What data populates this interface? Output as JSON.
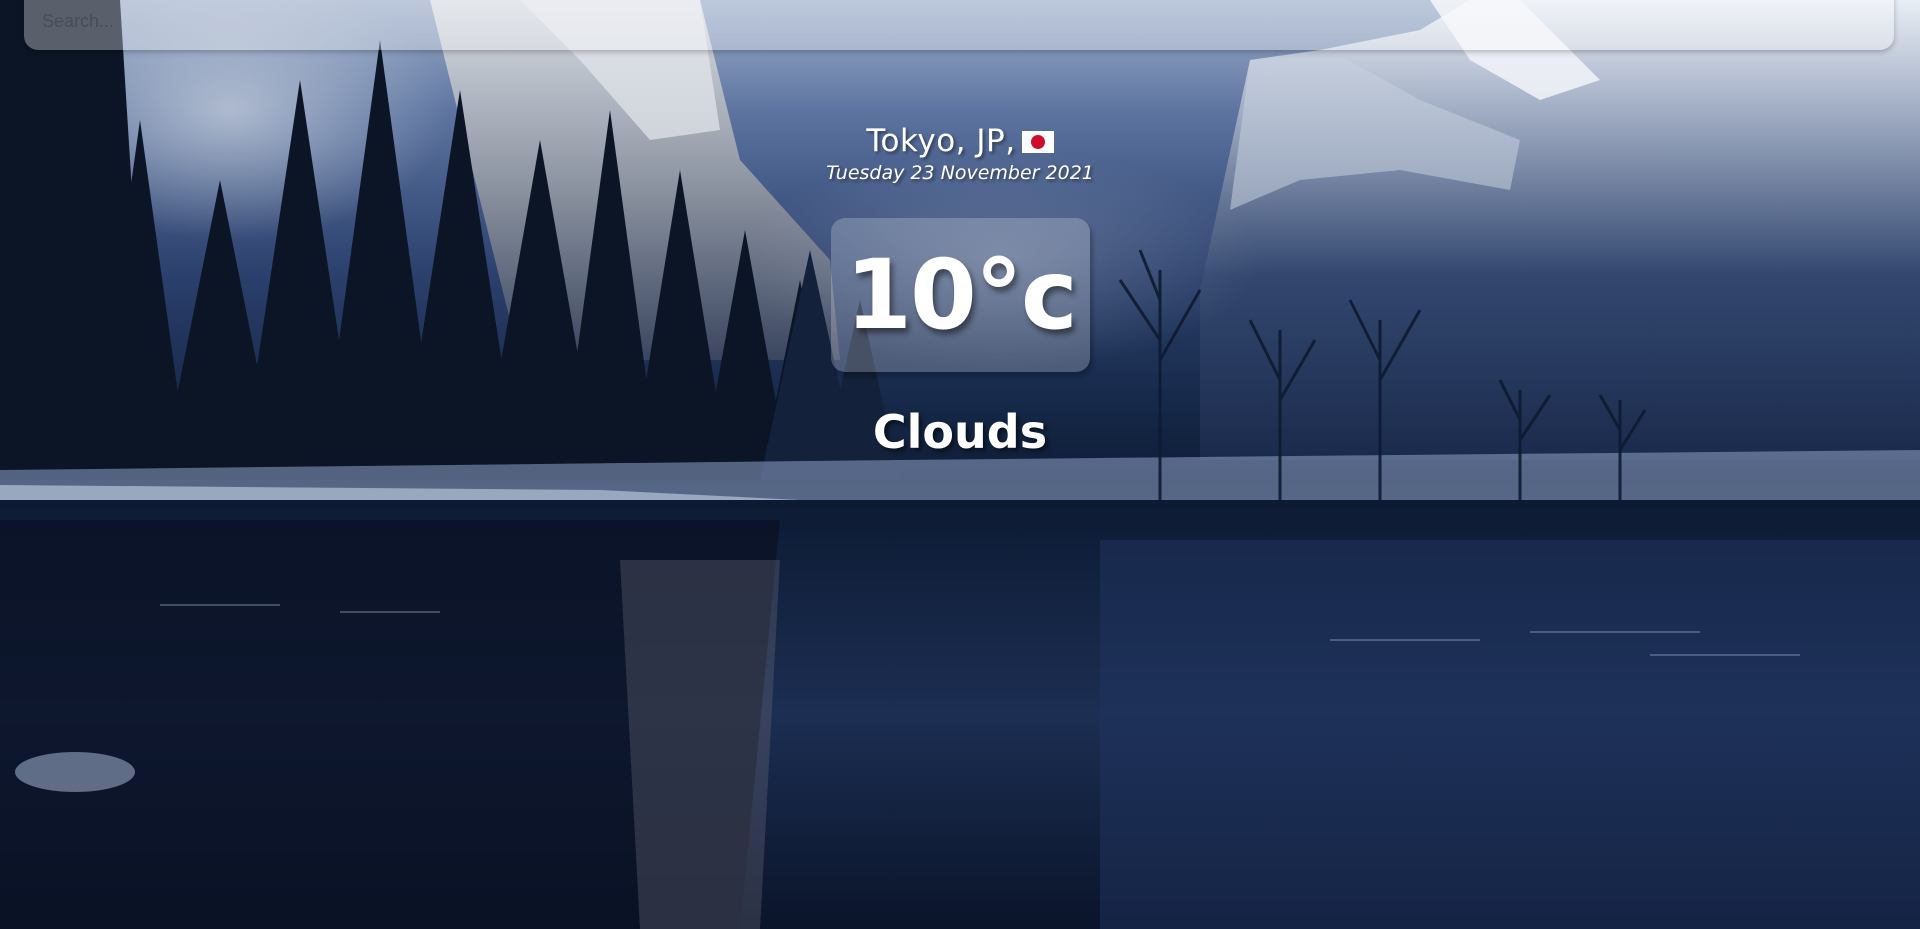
{
  "search": {
    "placeholder": "Search...",
    "value": ""
  },
  "location": {
    "city_country": "Tokyo, JP,",
    "flag_icon": "japan-flag-icon",
    "date": "Tuesday 23 November 2021"
  },
  "weather": {
    "temperature": "10°c",
    "condition": "Clouds"
  },
  "colors": {
    "text": "#ffffff",
    "flag_red": "#cf0d2a",
    "panel": "rgba(255,255,255,0.22)"
  }
}
